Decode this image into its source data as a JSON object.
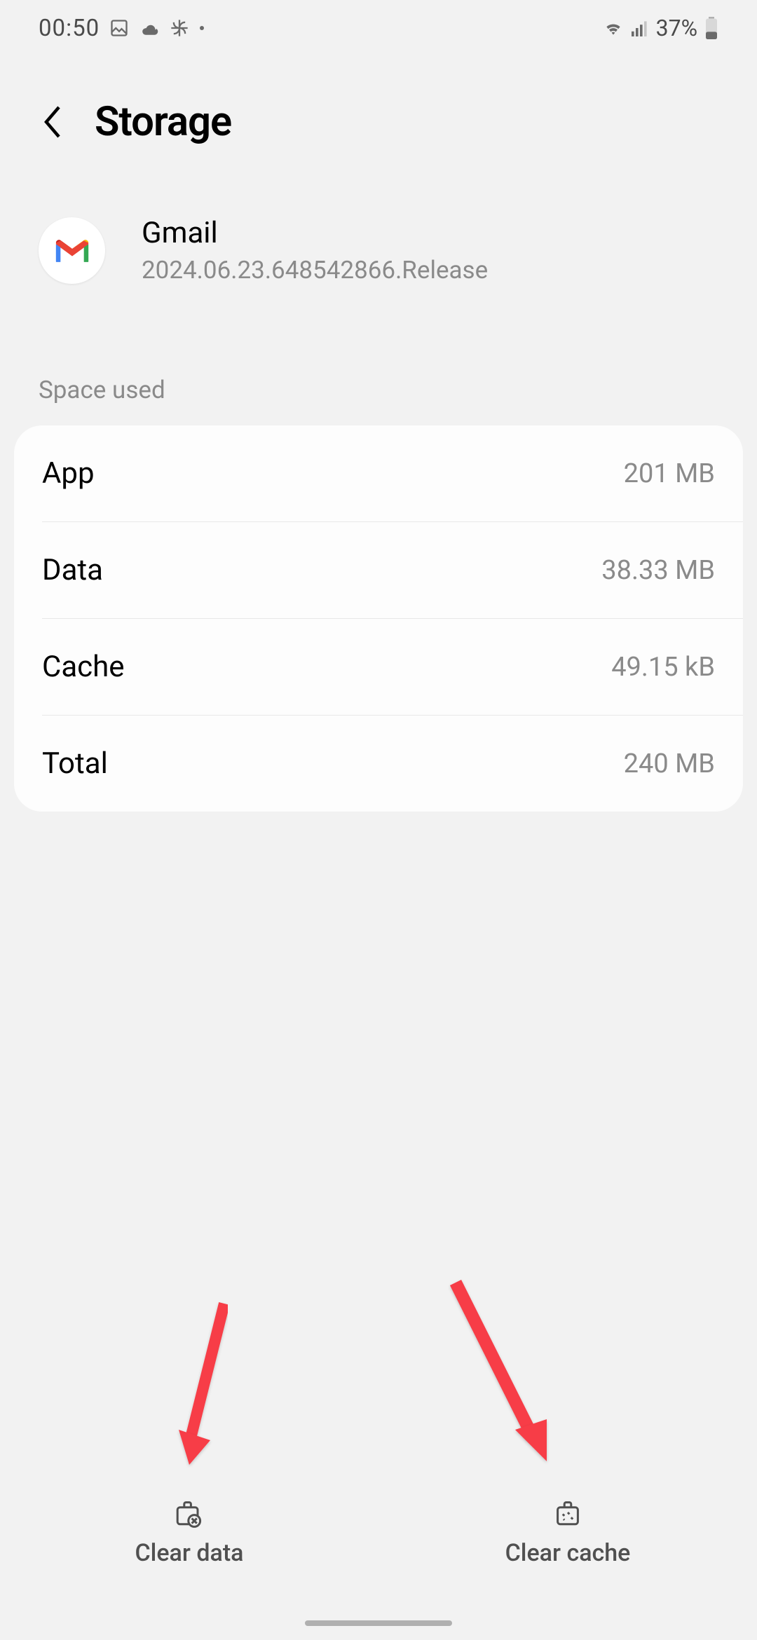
{
  "status": {
    "time": "00:50",
    "battery": "37%"
  },
  "header": {
    "title": "Storage"
  },
  "app": {
    "name": "Gmail",
    "version": "2024.06.23.648542866.Release"
  },
  "section": {
    "space_used": "Space used"
  },
  "rows": {
    "app": {
      "label": "App",
      "value": "201 MB"
    },
    "data": {
      "label": "Data",
      "value": "38.33 MB"
    },
    "cache": {
      "label": "Cache",
      "value": "49.15 kB"
    },
    "total": {
      "label": "Total",
      "value": "240 MB"
    }
  },
  "bottom": {
    "clear_data": "Clear data",
    "clear_cache": "Clear cache"
  }
}
